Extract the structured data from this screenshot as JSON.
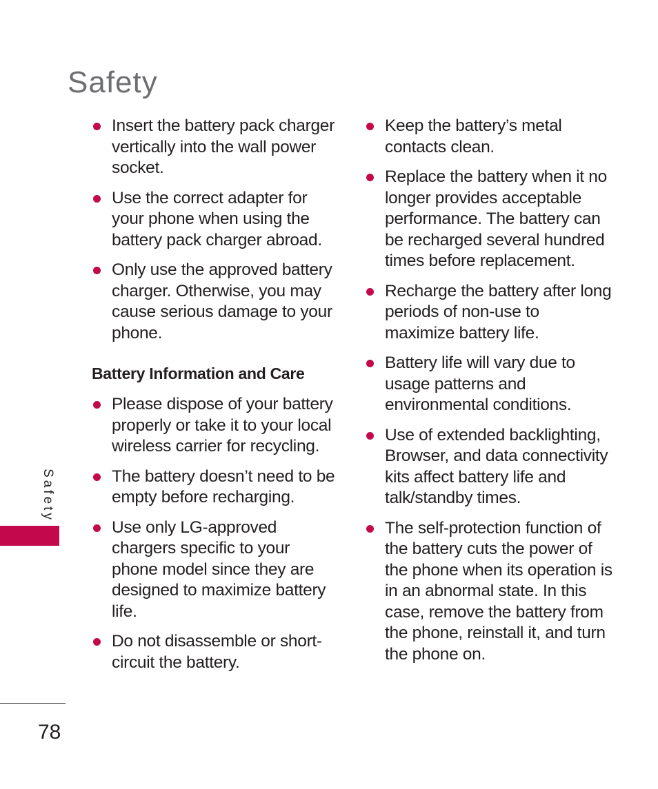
{
  "page": {
    "title": "Safety",
    "side_label": "Safety",
    "page_number": "78",
    "accent_color": "#c4084c"
  },
  "left_column": {
    "bullets_top": [
      "Insert the battery pack charger vertically into the wall power socket.",
      "Use the correct adapter for your phone when using the battery pack charger abroad.",
      "Only use the approved battery charger. Otherwise, you may cause serious damage to your phone."
    ],
    "section_heading": "Battery Information and Care",
    "bullets_bottom": [
      "Please dispose of your battery properly or take it to your local wireless carrier for recycling.",
      "The battery doesn’t need to be empty before recharging.",
      "Use only LG-approved chargers specific to your phone model since they are designed to maximize battery life.",
      "Do not disassemble or short-circuit the battery."
    ]
  },
  "right_column": {
    "bullets": [
      "Keep the battery’s metal contacts clean.",
      "Replace the battery when it no longer provides acceptable performance. The battery can be recharged several hundred times before replacement.",
      "Recharge the battery after long periods of non-use to maximize battery life.",
      "Battery life will vary due to usage patterns and environmental conditions.",
      "Use of extended backlighting, Browser, and data connectivity kits affect battery life and talk/standby times.",
      "The self-protection function of the battery cuts the power of the phone when its operation is in an abnormal state. In this case, remove the battery from the phone, reinstall it, and turn the phone on."
    ]
  }
}
